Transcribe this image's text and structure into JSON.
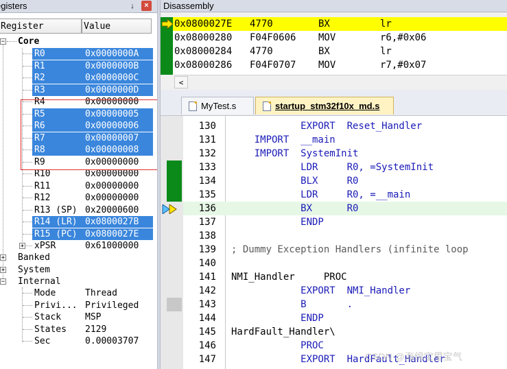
{
  "registers": {
    "title": "egisters",
    "pin_glyph": "↓",
    "close_glyph": "×",
    "col_register": "Register",
    "col_value": "Value",
    "core_label": "Core",
    "rows": [
      {
        "name": "R0",
        "value": "0x0000000A"
      },
      {
        "name": "R1",
        "value": "0x0000000B"
      },
      {
        "name": "R2",
        "value": "0x0000000C"
      },
      {
        "name": "R3",
        "value": "0x0000000D"
      },
      {
        "name": "R4",
        "value": "0x00000000"
      },
      {
        "name": "R5",
        "value": "0x00000005"
      },
      {
        "name": "R6",
        "value": "0x00000006"
      },
      {
        "name": "R7",
        "value": "0x00000007"
      },
      {
        "name": "R8",
        "value": "0x00000008"
      },
      {
        "name": "R9",
        "value": "0x00000000"
      },
      {
        "name": "R10",
        "value": "0x00000000"
      },
      {
        "name": "R11",
        "value": "0x00000000"
      },
      {
        "name": "R12",
        "value": "0x00000000"
      },
      {
        "name": "R13 (SP)",
        "value": "0x20000600"
      },
      {
        "name": "R14 (LR)",
        "value": "0x0800027B"
      },
      {
        "name": "R15 (PC)",
        "value": "0x0800027E"
      },
      {
        "name": "xPSR",
        "value": "0x61000000"
      }
    ],
    "banked_label": "Banked",
    "system_label": "System",
    "internal_label": "Internal",
    "internal_rows": [
      {
        "name": "Mode",
        "value": "Thread"
      },
      {
        "name": "Privi...",
        "value": "Privileged"
      },
      {
        "name": "Stack",
        "value": "MSP"
      },
      {
        "name": "States",
        "value": "2129"
      },
      {
        "name": "Sec",
        "value": "0.00003707"
      }
    ]
  },
  "disassembly": {
    "title": "Disassembly",
    "rows": [
      {
        "addr": "0x0800027E",
        "opcode": "4770",
        "mnemonic": "BX",
        "operands": "lr"
      },
      {
        "addr": "0x08000280",
        "opcode": "F04F0606",
        "mnemonic": "MOV",
        "operands": "r6,#0x06"
      },
      {
        "addr": "0x08000284",
        "opcode": "4770",
        "mnemonic": "BX",
        "operands": "lr"
      },
      {
        "addr": "0x08000286",
        "opcode": "F04F0707",
        "mnemonic": "MOV",
        "operands": "r7,#0x07"
      }
    ],
    "scroll_left_glyph": "<"
  },
  "tabs": [
    {
      "label": "MyTest.s"
    },
    {
      "label": "startup_stm32f10x_md.s"
    }
  ],
  "editor": {
    "lines": [
      {
        "n": "130",
        "code": "            EXPORT  Reset_Handler"
      },
      {
        "n": "131",
        "code": "    IMPORT  __main"
      },
      {
        "n": "132",
        "code": "    IMPORT  SystemInit"
      },
      {
        "n": "133",
        "code": "            LDR     R0, =SystemInit"
      },
      {
        "n": "134",
        "code": "            BLX     R0"
      },
      {
        "n": "135",
        "code": "            LDR     R0, =__main"
      },
      {
        "n": "136",
        "code": "            BX      R0"
      },
      {
        "n": "137",
        "code": "            ENDP"
      },
      {
        "n": "138",
        "code": ""
      },
      {
        "n": "139",
        "code": "; Dummy Exception Handlers (infinite loop"
      },
      {
        "n": "140",
        "code": ""
      },
      {
        "n": "141",
        "code": "NMI_Handler     PROC"
      },
      {
        "n": "142",
        "code": "            EXPORT  NMI_Handler"
      },
      {
        "n": "143",
        "code": "            B       ."
      },
      {
        "n": "144",
        "code": "            ENDP"
      },
      {
        "n": "145",
        "code": "HardFault_Handler\\"
      },
      {
        "n": "146",
        "code": "            PROC"
      },
      {
        "n": "147",
        "code": "            EXPORT  HardFault_Handler"
      }
    ]
  },
  "watermark": "CSDN @海绵宝里宝气",
  "colors": {
    "selection": "#3a86dc",
    "gutter_green": "#0b8a1a",
    "pc_highlight": "#ffff00",
    "highlight_box": "#e03030"
  }
}
